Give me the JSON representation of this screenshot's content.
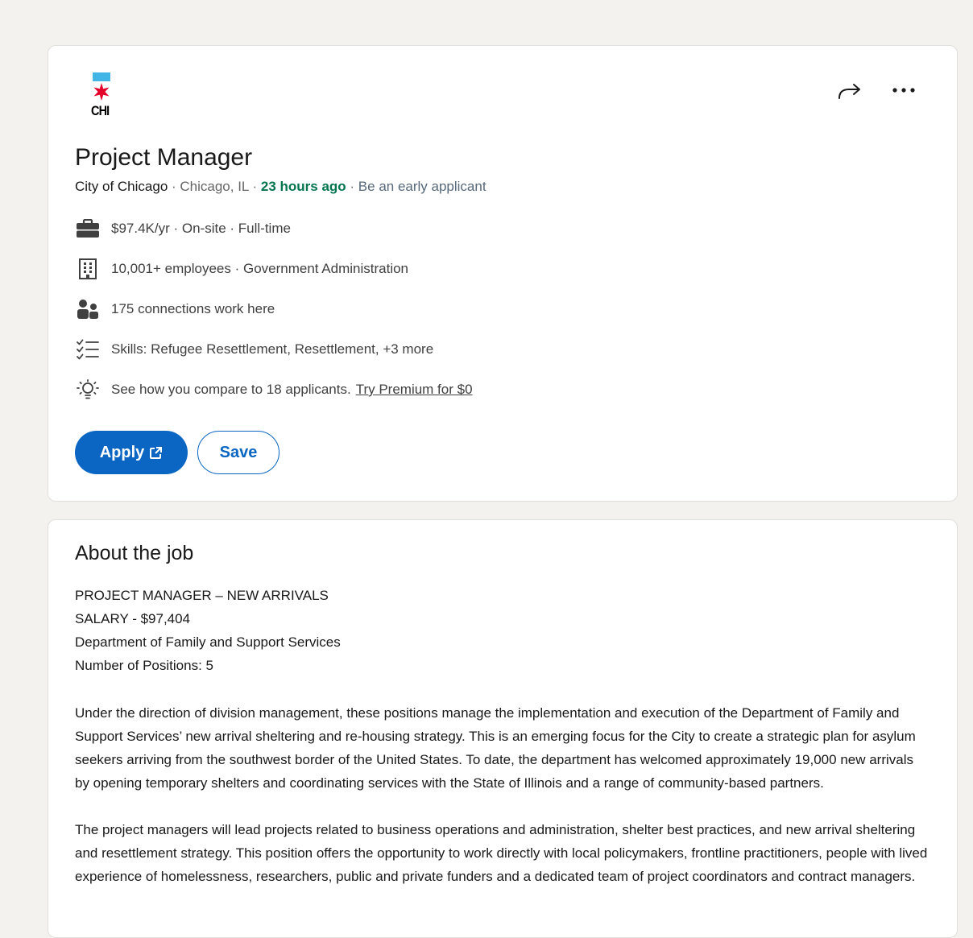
{
  "header": {
    "logo_text": "CHI",
    "title": "Project Manager",
    "company": "City of Chicago",
    "location": "Chicago, IL",
    "posted": "23 hours ago",
    "early": "Be an early applicant",
    "separator": " · "
  },
  "insights": [
    {
      "icon": "briefcase-icon",
      "text": "$97.4K/yr · On-site · Full-time"
    },
    {
      "icon": "building-icon",
      "text": "10,001+ employees · Government Administration"
    },
    {
      "icon": "people-icon",
      "text": "175 connections work here"
    },
    {
      "icon": "checklist-icon",
      "text": "Skills: Refugee Resettlement, Resettlement, +3 more"
    },
    {
      "icon": "lightbulb-icon",
      "text": "See how you compare to 18 applicants.",
      "link": "Try Premium for $0"
    }
  ],
  "actions": {
    "apply_label": "Apply",
    "save_label": "Save"
  },
  "about": {
    "heading": "About the job",
    "line1": "PROJECT MANAGER – NEW ARRIVALS",
    "line2": "SALARY - $97,404",
    "line3": "Department of Family and Support Services",
    "line4": "Number of Positions: 5",
    "para1": "Under the direction of division management, these positions manage the implementation and execution of the Department of Family and Support Services’ new arrival sheltering and re-housing strategy. This is an emerging focus for the City to create a strategic plan for asylum seekers arriving from the southwest border of the United States. To date, the department has welcomed approximately 19,000 new arrivals by opening temporary shelters and coordinating services with the State of Illinois and a range of community-based partners.",
    "para2": "The project managers will lead projects related to business operations and administration, shelter best practices, and new arrival sheltering and resettlement strategy. This position offers the opportunity to work directly with local policymakers, frontline practitioners, people with lived experience of homelessness, researchers, public and private funders and a dedicated team of project coordinators and contract managers."
  },
  "colors": {
    "accent": "#0a66c2",
    "posted_green": "#01754f",
    "logo_blue": "#41b6e6",
    "logo_red": "#e4002b"
  }
}
